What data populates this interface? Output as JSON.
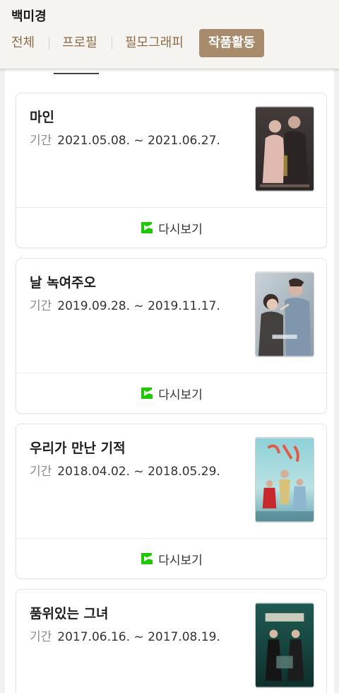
{
  "header": {
    "person_name": "백미경",
    "tabs": [
      {
        "label": "전체",
        "active": false
      },
      {
        "label": "프로필",
        "active": false
      },
      {
        "label": "필모그래피",
        "active": false
      },
      {
        "label": "작품활동",
        "active": true
      }
    ]
  },
  "colors": {
    "accent": "#a88b6a",
    "tab_text": "#8b6b4a",
    "replay_icon": "#1ec800"
  },
  "works": [
    {
      "title": "마인",
      "period_label": "기간",
      "period": "2021.05.08. ~ 2021.06.27.",
      "replay_label": "다시보기",
      "poster_icon": "drama-poster-mine"
    },
    {
      "title": "날 녹여주오",
      "period_label": "기간",
      "period": "2019.09.28. ~ 2019.11.17.",
      "replay_label": "다시보기",
      "poster_icon": "drama-poster-melting-me-softly"
    },
    {
      "title": "우리가 만난 기적",
      "period_label": "기간",
      "period": "2018.04.02. ~ 2018.05.29.",
      "replay_label": "다시보기",
      "poster_icon": "drama-poster-miracle-we-met"
    },
    {
      "title": "품위있는 그녀",
      "period_label": "기간",
      "period": "2017.06.16. ~ 2017.08.19.",
      "replay_label": "다시보기",
      "poster_icon": "drama-poster-elegant-her"
    }
  ]
}
